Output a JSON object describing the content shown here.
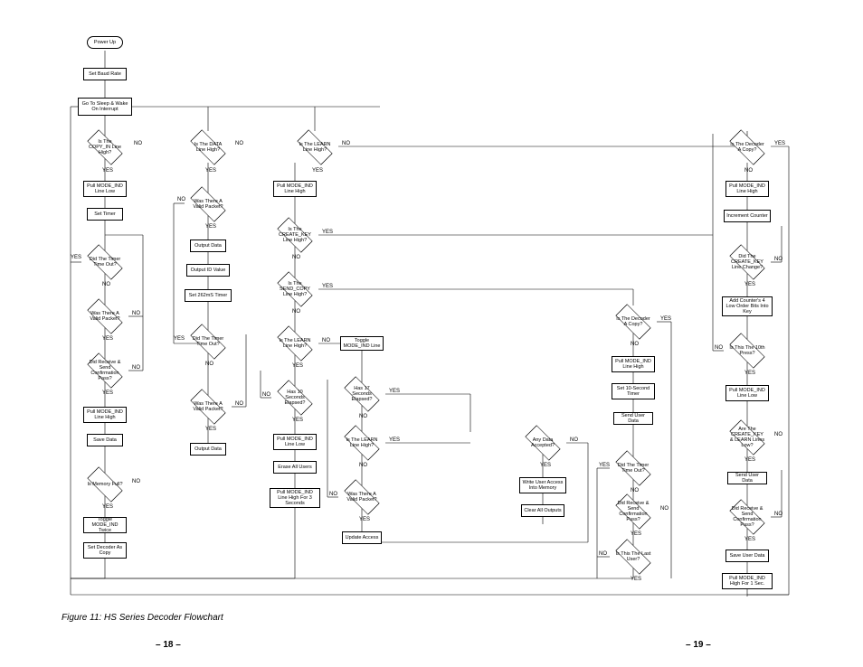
{
  "caption": "Figure 11: HS Series Decoder Flowchart",
  "pageLeft": "– 18 –",
  "pageRight": "– 19 –",
  "labels": {
    "yes": "YES",
    "no": "NO"
  },
  "n": {
    "powerUp": "Power Up",
    "setBaud": "Set Baud Rate",
    "sleep": "Go To Sleep & Wake On Interrupt",
    "copyIn": "Is The COPY_IN Line High?",
    "pullLow1": "Pull MODE_IND Line Low",
    "setTimer": "Set Timer",
    "timerOut1": "Did The Timer Time Out?",
    "validPkt1": "Was There A Valid Packet?",
    "recvConf1": "Did Receive & Send Confirmation Pass?",
    "pullHigh1": "Pull MODE_IND Line High",
    "saveData1": "Save Data",
    "memFull": "Is Memory Full?",
    "toggleTwice": "Toggle MODE_IND Twice",
    "setDecCopy": "Set Decoder As Copy",
    "dataHigh": "Is The DATA Line High?",
    "validPkt2": "Was There A Valid Packet?",
    "outData1": "Output Data",
    "outID": "Output ID Value",
    "set262": "Set 262mS Timer",
    "timerOut2": "Did The Timer Time Out?",
    "validPkt3": "Was There A Valid Packet?",
    "outData2": "Output Data",
    "learnHigh": "Is The LEARN Line High?",
    "pullHigh2": "Pull MODE_IND Line High",
    "createKey": "Is The CREATE_KEY Line High?",
    "sendCopy": "Is The SEND_COPY Line High?",
    "learnHigh2": "Is The LEARN Line High?",
    "ten": "Has 10 Seconds Elapsed?",
    "pullLow2": "Pull MODE_IND Line Low",
    "eraseAll": "Erase All Users",
    "pullHigh3": "Pull MODE_IND Line High For 3 Seconds",
    "toggleLine": "Toggle MODE_IND Line",
    "seventeen": "Has 17 Seconds Elapsed?",
    "learnHigh3": "Is The LEARN Line High?",
    "validPkt4": "Was There A Valid Packet?",
    "updateAcc": "Update Access",
    "anyData": "Any Data Accepted?",
    "writeUA": "Write User Access Into Memory",
    "clearOut": "Clear All Outputs",
    "decCopy1": "Is The Decoder A Copy?",
    "pullHigh4": "Pull MODE_IND Line High",
    "set10s": "Set 10-Second Timer",
    "sendUD1": "Send User Data",
    "timerOut3": "Did The Timer Time Out?",
    "recvConf2": "Did Receive & Send Confirmation Pass?",
    "lastUser": "Is This The Last User?",
    "decCopy2": "Is The Decoder A Copy?",
    "pullHigh5": "Pull MODE_IND Line High",
    "incCtr": "Increment Counter",
    "ckChange": "Did The CREATE_KEY Line Change?",
    "addBits": "Add Counter's 4 Low Order Bits Into Key",
    "tenth": "Is This The 10th Press?",
    "pullLow3": "Pull MODE_IND Line Low",
    "learnLow": "Are The CREATE_KEY & LEARN Lines Low?",
    "sendUD2": "Send User Data",
    "recvConf3": "Did Receive & Send Confirmation Pass?",
    "saveUD": "Save User Data",
    "pullHigh6": "Pull MODE_IND High For 1 Sec."
  }
}
